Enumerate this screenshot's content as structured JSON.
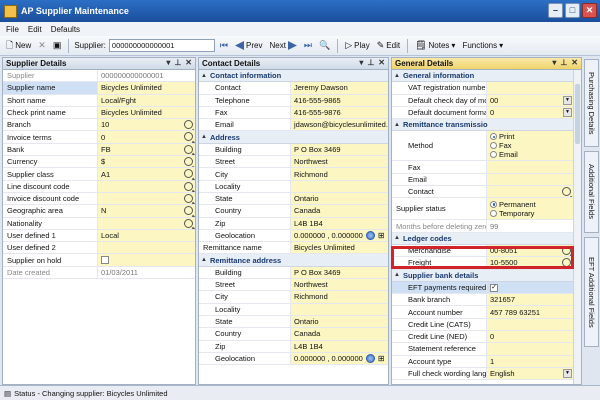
{
  "window": {
    "title": "AP Supplier Maintenance"
  },
  "menu": [
    "File",
    "Edit",
    "Defaults"
  ],
  "toolbar": {
    "new": "New",
    "supplier_label": "Supplier:",
    "supplier_code": "000000000000001",
    "prev": "Prev",
    "next": "Next",
    "play": "Play",
    "edit": "Edit",
    "notes": "Notes",
    "functions": "Functions"
  },
  "supplier_details": {
    "title": "Supplier Details",
    "rows": [
      {
        "label": "Supplier",
        "value": "000000000000001",
        "style": "gray"
      },
      {
        "label": "Supplier name",
        "value": "Bicycles Unlimited",
        "sel": true
      },
      {
        "label": "Short name",
        "value": "Local/Fght"
      },
      {
        "label": "Check print name",
        "value": "Bicycles Unlimited"
      },
      {
        "label": "Branch",
        "value": "10",
        "icon": "search"
      },
      {
        "label": "Invoice terms",
        "value": "0",
        "icon": "search"
      },
      {
        "label": "Bank",
        "value": "FB",
        "icon": "search"
      },
      {
        "label": "Currency",
        "value": "$",
        "icon": "search"
      },
      {
        "label": "Supplier class",
        "value": "A1",
        "icon": "search"
      },
      {
        "label": "Line discount code",
        "value": "",
        "icon": "search"
      },
      {
        "label": "Invoice discount code",
        "value": "",
        "icon": "search"
      },
      {
        "label": "Geographic area",
        "value": "N",
        "icon": "search"
      },
      {
        "label": "Nationality",
        "value": "",
        "icon": "search"
      },
      {
        "label": "User defined 1",
        "value": "Local"
      },
      {
        "label": "User defined 2",
        "value": ""
      },
      {
        "label": "Supplier on hold",
        "value": "",
        "checkbox": true
      },
      {
        "label": "Date created",
        "value": "01/03/2011",
        "style": "gray"
      }
    ]
  },
  "contact_details": {
    "title": "Contact Details",
    "contact_section": "Contact information",
    "contact_rows": [
      {
        "label": "Contact",
        "value": "Jeremy Dawson"
      },
      {
        "label": "Telephone",
        "value": "416-555-9865"
      },
      {
        "label": "Fax",
        "value": "416-555-9876"
      },
      {
        "label": "Email",
        "value": "jdawson@bicyclesunlimited.com"
      }
    ],
    "address_section": "Address",
    "address_rows": [
      {
        "label": "Building",
        "value": "P O Box 3469"
      },
      {
        "label": "Street",
        "value": "Northwest"
      },
      {
        "label": "City",
        "value": "Richmond"
      },
      {
        "label": "Locality",
        "value": ""
      },
      {
        "label": "State",
        "value": "Ontario"
      },
      {
        "label": "Country",
        "value": "Canada"
      },
      {
        "label": "Zip",
        "value": "L4B 1B4"
      }
    ],
    "geolocation_label": "Geolocation",
    "geolocation_value": "0.000000 , 0.000000",
    "remittance_name_label": "Remittance name",
    "remittance_name_value": "Bicycles Unlimited",
    "remit_section": "Remittance address",
    "remit_rows": [
      {
        "label": "Building",
        "value": "P O Box 3469"
      },
      {
        "label": "Street",
        "value": "Northwest"
      },
      {
        "label": "City",
        "value": "Richmond"
      },
      {
        "label": "Locality",
        "value": ""
      },
      {
        "label": "State",
        "value": "Ontario"
      },
      {
        "label": "Country",
        "value": "Canada"
      },
      {
        "label": "Zip",
        "value": "L4B 1B4"
      }
    ],
    "remit_geolocation_value": "0.000000 , 0.000000"
  },
  "general_details": {
    "title": "General Details",
    "general_section": "General information",
    "vat_label": "VAT registration number",
    "check_day_label": "Default check day of mor",
    "check_day_value": "00",
    "doc_format_label": "Default document format",
    "doc_format_value": "0",
    "remit_section": "Remittance transmissio",
    "method_label": "Method",
    "method_options": [
      "Print",
      "Fax",
      "Email"
    ],
    "fax_label": "Fax",
    "email_label": "Email",
    "contact_label": "Contact",
    "status_label": "Supplier status",
    "status_options": [
      "Permanent",
      "Temporary"
    ],
    "months_label": "Months before deleting zero",
    "months_value": "99",
    "ledger_section": "Ledger codes",
    "merch_label": "Merchandise",
    "merch_value": "00-8051",
    "freight_label": "Freight",
    "freight_value": "10-5500",
    "bank_section": "Supplier bank details",
    "eft_label": "EFT payments required",
    "eft_checked": "✓",
    "bank_branch_label": "Bank branch",
    "bank_branch_value": "321657",
    "account_label": "Account number",
    "account_value": "457 789 63251",
    "cats_label": "Credit Line (CATS)",
    "ned_label": "Credit Line (NED)",
    "ned_value": "0",
    "stmt_label": "Statement reference",
    "acct_type_label": "Account type",
    "acct_type_value": "1",
    "wording_label": "Full check wording langua",
    "wording_value": "English"
  },
  "side_tabs": [
    "Purchasing Details",
    "Additional Fields",
    "EFT Additional Fields"
  ],
  "status": {
    "text": "Status - Changing supplier: Bicycles Unlimited"
  }
}
